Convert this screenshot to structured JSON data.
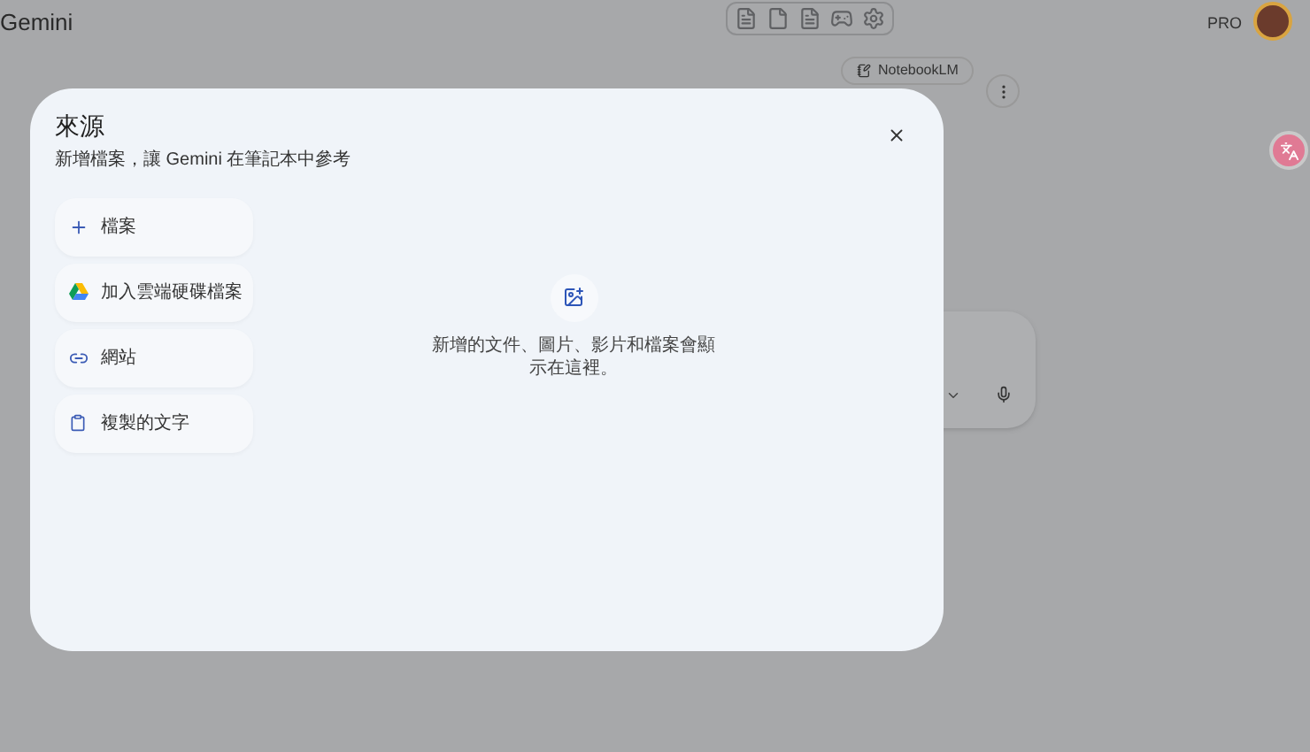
{
  "header": {
    "app_name": "Gemini",
    "plan_badge": "PRO"
  },
  "notebook_chip": {
    "label": "NotebookLM"
  },
  "dialog": {
    "title": "來源",
    "subtitle": "新增檔案，讓 Gemini 在筆記本中參考",
    "options": [
      {
        "kind": "file",
        "label": "檔案"
      },
      {
        "kind": "drive",
        "label": "加入雲端硬碟檔案"
      },
      {
        "kind": "website",
        "label": "網站"
      },
      {
        "kind": "text",
        "label": "複製的文字"
      }
    ],
    "empty_message": "新增的文件、圖片、影片和檔案會顯示在這裡。"
  }
}
